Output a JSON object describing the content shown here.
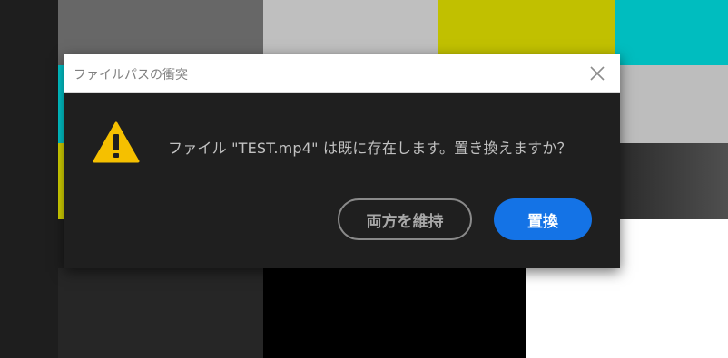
{
  "dialog": {
    "title": "ファイルパスの衝突",
    "close_icon": "close-icon",
    "warning_icon": "warning-triangle-icon",
    "message": "ファイル \"TEST.mp4\" は既に存在します。置き換えますか？",
    "buttons": {
      "keep_both": "両方を維持",
      "replace": "置換"
    }
  },
  "colors": {
    "accent_blue": "#1473e6",
    "warning_yellow": "#f5c000",
    "dialog_body": "#1f1f1f",
    "dialog_header": "#ffffff"
  }
}
